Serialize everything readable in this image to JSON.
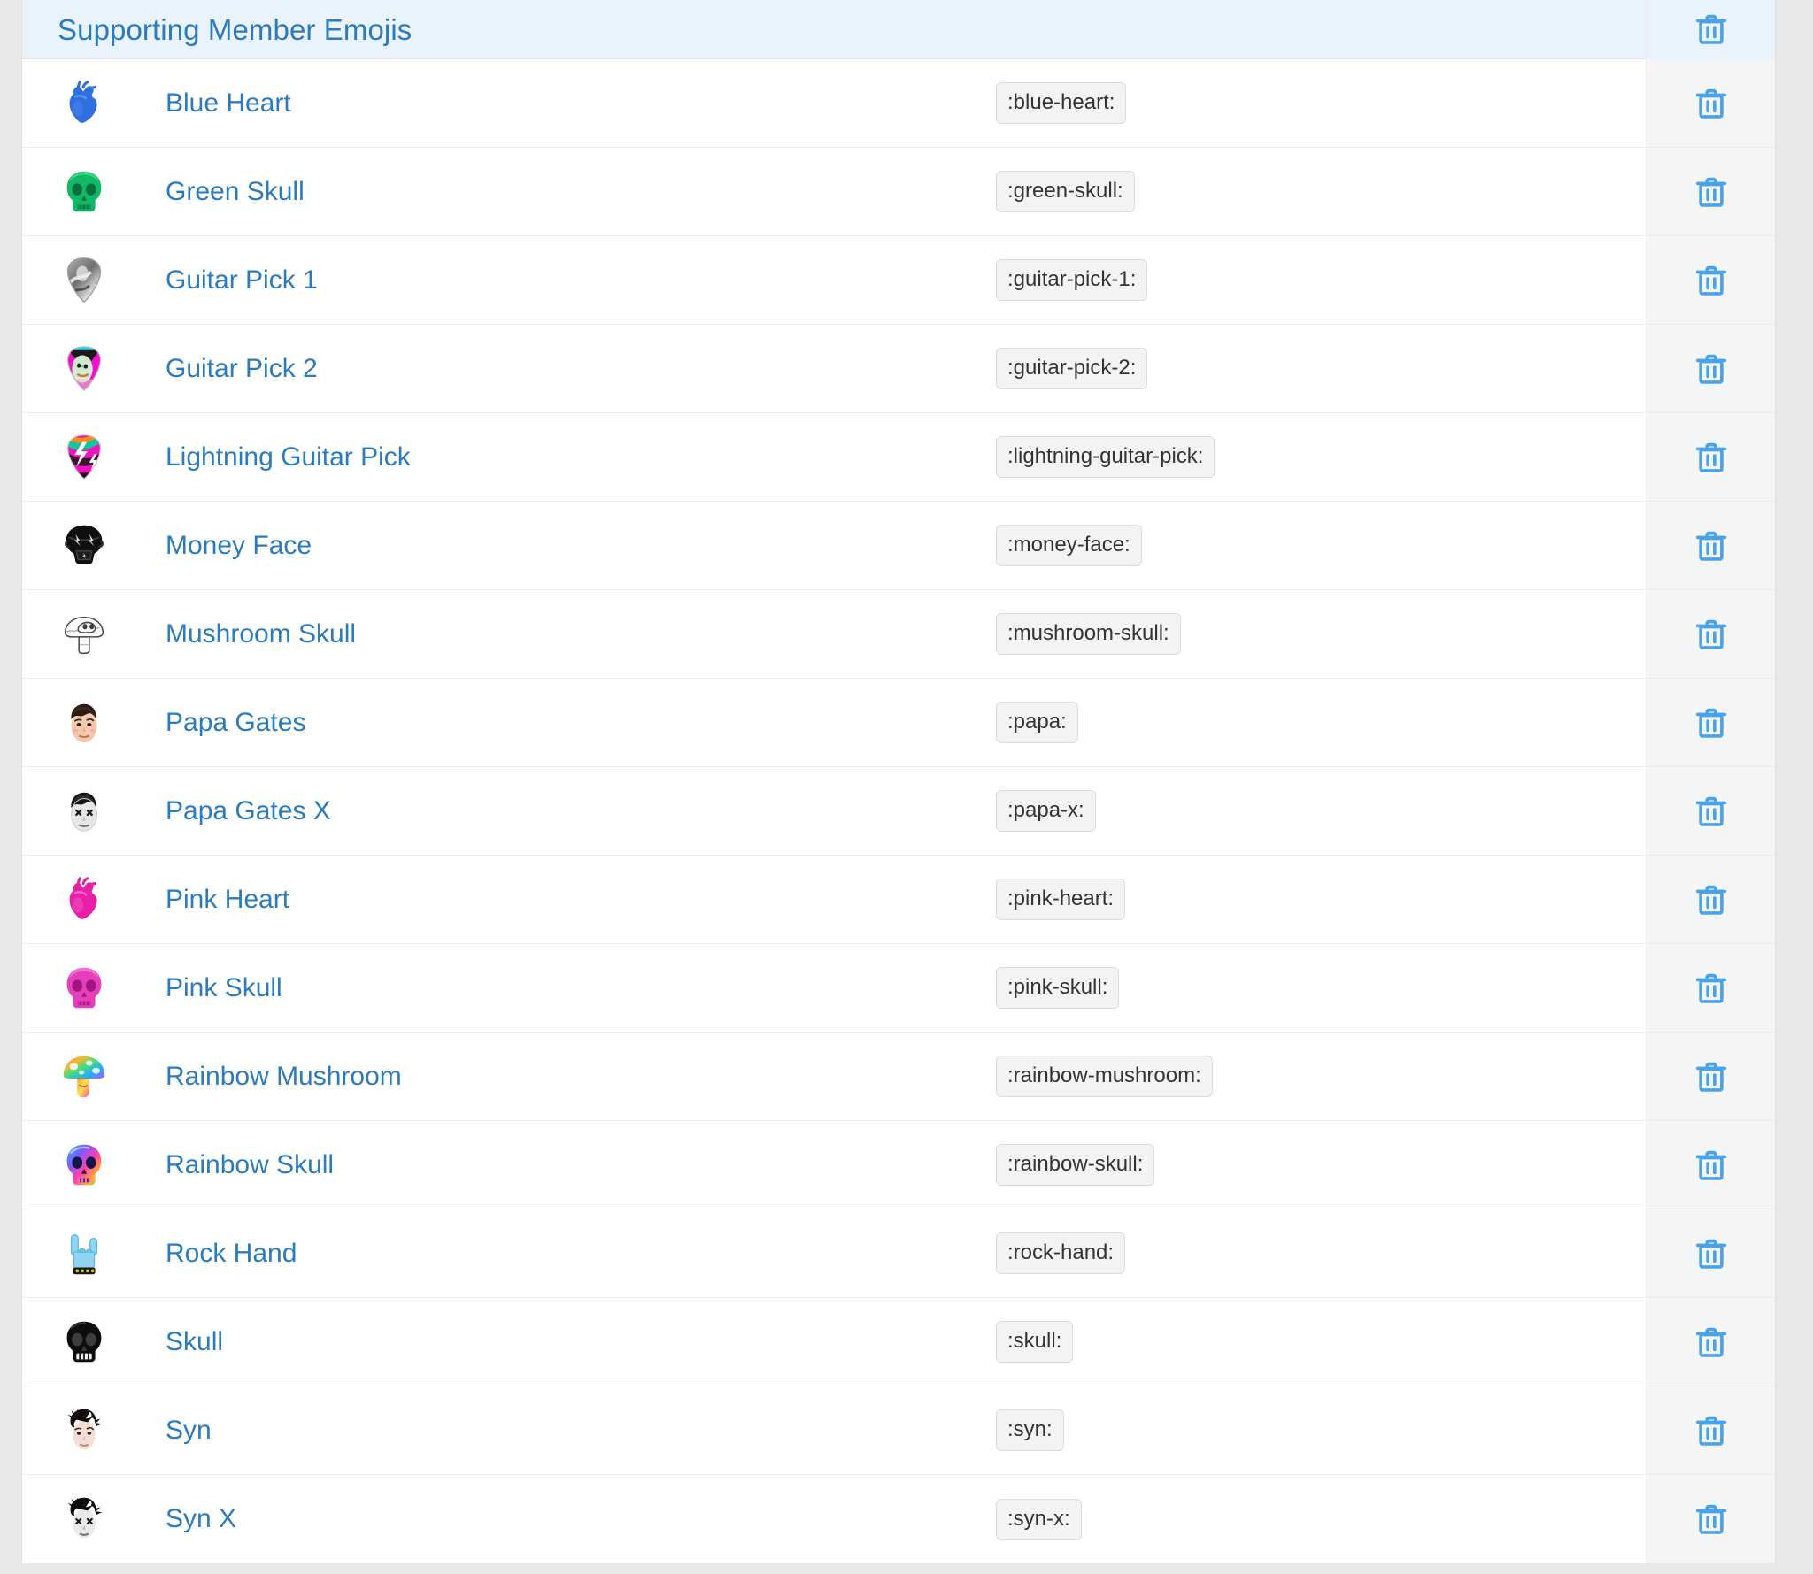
{
  "header": {
    "title": "Supporting Member Emojis",
    "delete_all_icon": "trash-icon"
  },
  "colors": {
    "header_background": "#eaf2fb",
    "link_blue": "#2b7bbd",
    "trash_blue": "#4aa3e8",
    "row_background": "#ffffff",
    "action_column_background": "#f5f5f5",
    "page_background": "#e8e8e8",
    "chip_background": "#f3f3f3",
    "chip_border": "#dcdcdc",
    "row_border": "#ededed"
  },
  "rows": [
    {
      "name": "Blue Heart",
      "code": ":blue-heart:",
      "icon": "blue-heart-emoji"
    },
    {
      "name": "Green Skull",
      "code": ":green-skull:",
      "icon": "green-skull-emoji"
    },
    {
      "name": "Guitar Pick 1",
      "code": ":guitar-pick-1:",
      "icon": "guitar-pick-1-emoji"
    },
    {
      "name": "Guitar Pick 2",
      "code": ":guitar-pick-2:",
      "icon": "guitar-pick-2-emoji"
    },
    {
      "name": "Lightning Guitar Pick",
      "code": ":lightning-guitar-pick:",
      "icon": "lightning-guitar-pick-emoji"
    },
    {
      "name": "Money Face",
      "code": ":money-face:",
      "icon": "money-face-emoji"
    },
    {
      "name": "Mushroom Skull",
      "code": ":mushroom-skull:",
      "icon": "mushroom-skull-emoji"
    },
    {
      "name": "Papa Gates",
      "code": ":papa:",
      "icon": "papa-gates-emoji"
    },
    {
      "name": "Papa Gates X",
      "code": ":papa-x:",
      "icon": "papa-gates-x-emoji"
    },
    {
      "name": "Pink Heart",
      "code": ":pink-heart:",
      "icon": "pink-heart-emoji"
    },
    {
      "name": "Pink Skull",
      "code": ":pink-skull:",
      "icon": "pink-skull-emoji"
    },
    {
      "name": "Rainbow Mushroom",
      "code": ":rainbow-mushroom:",
      "icon": "rainbow-mushroom-emoji"
    },
    {
      "name": "Rainbow Skull",
      "code": ":rainbow-skull:",
      "icon": "rainbow-skull-emoji"
    },
    {
      "name": "Rock Hand",
      "code": ":rock-hand:",
      "icon": "rock-hand-emoji"
    },
    {
      "name": "Skull",
      "code": ":skull:",
      "icon": "skull-emoji"
    },
    {
      "name": "Syn",
      "code": ":syn:",
      "icon": "syn-emoji"
    },
    {
      "name": "Syn X",
      "code": ":syn-x:",
      "icon": "syn-x-emoji"
    }
  ]
}
